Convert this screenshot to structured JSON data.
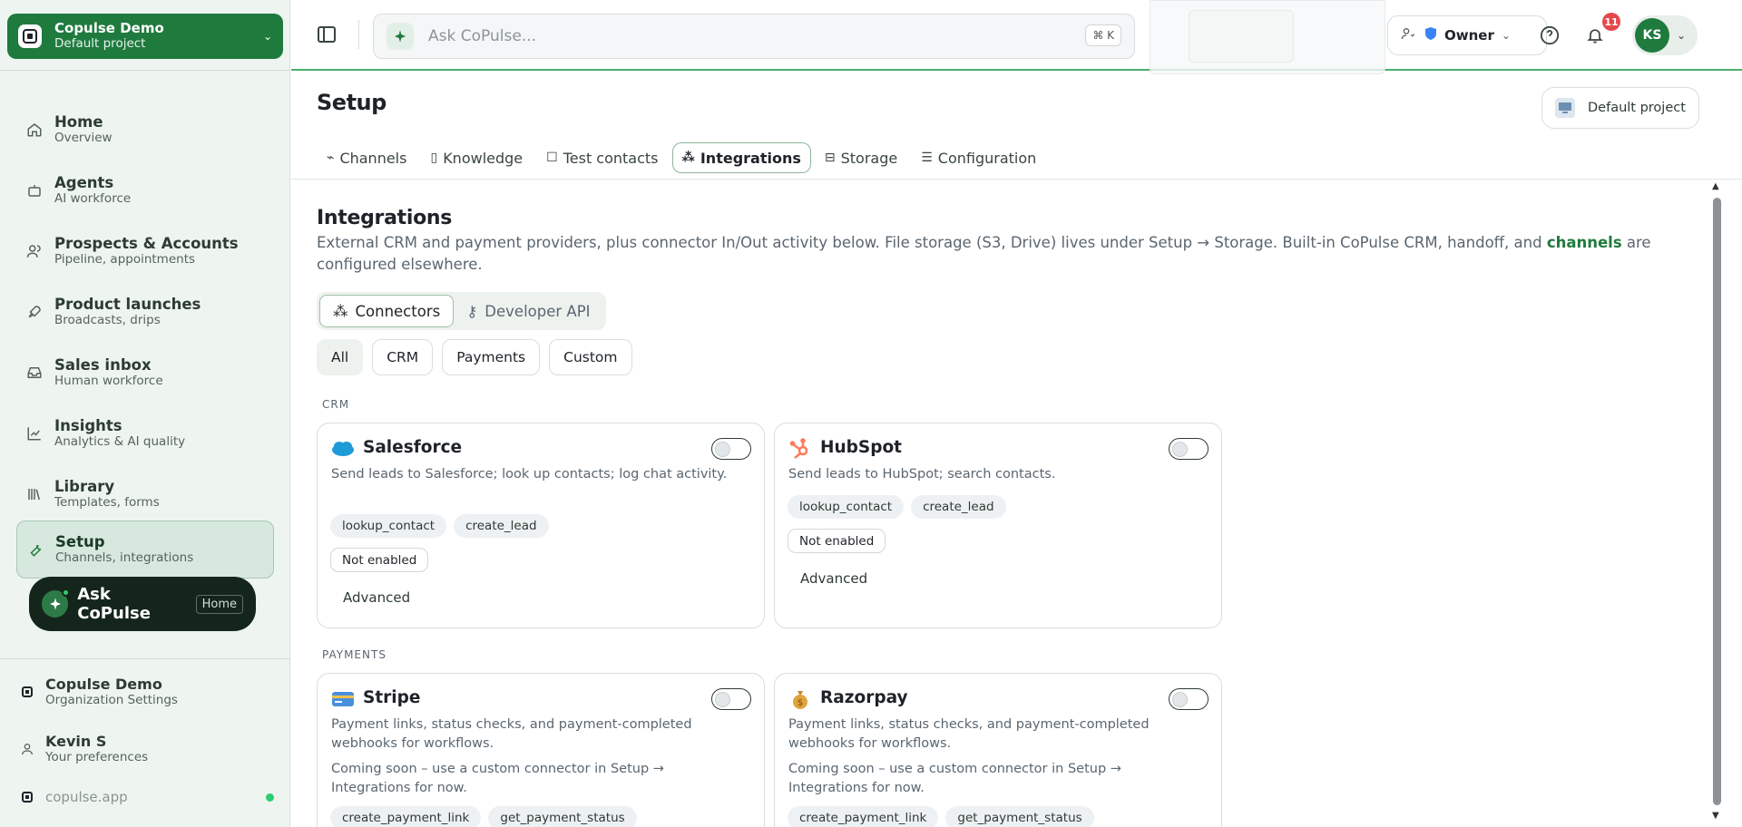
{
  "sidebar": {
    "project": {
      "name": "Copulse Demo",
      "sub": "Default project"
    },
    "items": [
      {
        "label": "Home",
        "sub": "Overview",
        "icon": "home-icon"
      },
      {
        "label": "Agents",
        "sub": "AI workforce",
        "icon": "robot-icon"
      },
      {
        "label": "Prospects & Accounts",
        "sub": "Pipeline, appointments",
        "icon": "users-icon"
      },
      {
        "label": "Product launches",
        "sub": "Broadcasts, drips",
        "icon": "rocket-icon"
      },
      {
        "label": "Sales inbox",
        "sub": "Human workforce",
        "icon": "inbox-icon"
      },
      {
        "label": "Insights",
        "sub": "Analytics & AI quality",
        "icon": "chart-icon"
      },
      {
        "label": "Library",
        "sub": "Templates, forms",
        "icon": "library-icon"
      },
      {
        "label": "Setup",
        "sub": "Channels, integrations",
        "icon": "wrench-icon"
      }
    ],
    "ask": {
      "label": "Ask CoPulse",
      "tag": "Home"
    },
    "footer": {
      "org": {
        "name": "Copulse Demo",
        "sub": "Organization Settings"
      },
      "user": {
        "name": "Kevin S",
        "sub": "Your preferences"
      },
      "domain": "copulse.app"
    }
  },
  "topbar": {
    "search_placeholder": "Ask CoPulse...",
    "shortcut": "⌘ K",
    "role": "Owner",
    "notifications": "11",
    "avatar": "KS"
  },
  "page": {
    "title": "Setup",
    "project_button": "Default project",
    "tabs": [
      {
        "label": "Channels",
        "icon": "plug-icon"
      },
      {
        "label": "Knowledge",
        "icon": "book-icon"
      },
      {
        "label": "Test contacts",
        "icon": "contact-icon"
      },
      {
        "label": "Integrations",
        "icon": "integrations-icon"
      },
      {
        "label": "Storage",
        "icon": "storage-icon"
      },
      {
        "label": "Configuration",
        "icon": "sliders-icon"
      }
    ]
  },
  "integrations": {
    "title": "Integrations",
    "desc_before": "External CRM and payment providers, plus connector In/Out activity below. File storage (S3, Drive) lives under Setup → Storage. Built-in CoPulse CRM, handoff, and ",
    "desc_link": "channels",
    "desc_after": " are configured elsewhere.",
    "subtabs": [
      "Connectors",
      "Developer API"
    ],
    "filters": [
      "All",
      "CRM",
      "Payments",
      "Custom"
    ],
    "groups": {
      "crm": "CRM",
      "payments": "PAYMENTS"
    },
    "cards": {
      "salesforce": {
        "name": "Salesforce",
        "desc": "Send leads to Salesforce; look up contacts; log chat activity.",
        "chips": [
          "lookup_contact",
          "create_lead"
        ],
        "status": "Not enabled",
        "advanced": "Advanced"
      },
      "hubspot": {
        "name": "HubSpot",
        "desc": "Send leads to HubSpot; search contacts.",
        "chips": [
          "lookup_contact",
          "create_lead"
        ],
        "status": "Not enabled",
        "advanced": "Advanced"
      },
      "stripe": {
        "name": "Stripe",
        "desc": "Payment links, status checks, and payment-completed webhooks for workflows.",
        "soon": "Coming soon – use a custom connector in Setup → Integrations for now.",
        "chips": [
          "create_payment_link",
          "get_payment_status"
        ]
      },
      "razorpay": {
        "name": "Razorpay",
        "desc": "Payment links, status checks, and payment-completed webhooks for workflows.",
        "soon": "Coming soon – use a custom connector in Setup → Integrations for now.",
        "chips": [
          "create_payment_link",
          "get_payment_status"
        ]
      }
    }
  },
  "colors": {
    "brand": "#1f7a3e",
    "accent": "#4caf6e",
    "notification": "#e5484d"
  }
}
